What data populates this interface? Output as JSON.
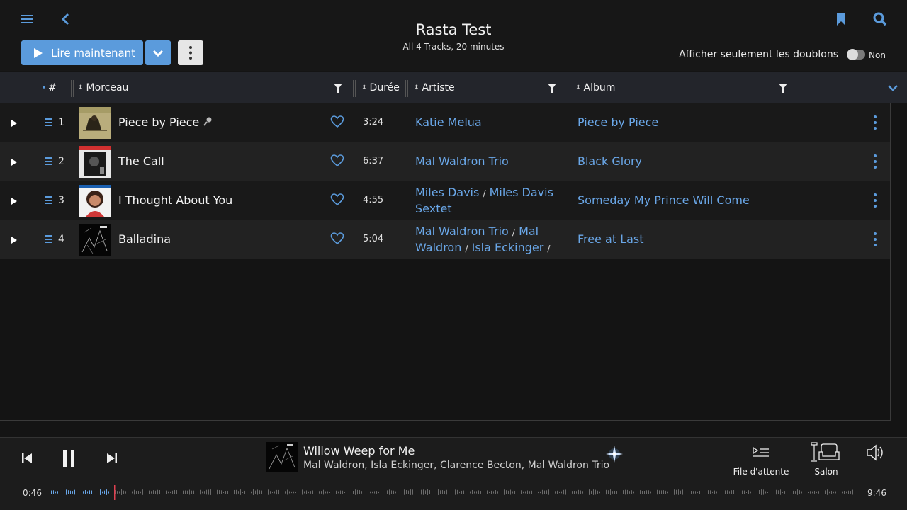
{
  "header": {
    "title": "Rasta Test",
    "subtitle": "All 4 Tracks, 20 minutes",
    "play_label": "Lire maintenant",
    "duplicates_label": "Afficher seulement les doublons",
    "duplicates_value": "Non",
    "icons": [
      "menu-icon",
      "back-chevron-icon",
      "bookmark-icon",
      "search-icon"
    ]
  },
  "columns": {
    "number": "#",
    "track": "Morceau",
    "duration": "Durée",
    "artist": "Artiste",
    "album": "Album"
  },
  "tracks": [
    {
      "num": "1",
      "title": "Piece by Piece",
      "duration": "3:24",
      "artists_line1": [
        "Katie Melua"
      ],
      "artists_line2": [],
      "album": "Piece by Piece"
    },
    {
      "num": "2",
      "title": "The Call",
      "duration": "6:37",
      "artists_line1": [
        "Mal Waldron Trio"
      ],
      "artists_line2": [],
      "album": "Black Glory"
    },
    {
      "num": "3",
      "title": "I Thought About You",
      "duration": "4:55",
      "artists_line1": [
        "Miles Davis",
        "Miles Davis"
      ],
      "artists_line2": [
        "Sextet"
      ],
      "album": "Someday My Prince Will Come"
    },
    {
      "num": "4",
      "title": "Balladina",
      "duration": "5:04",
      "artists_line1": [
        "Mal Waldron Trio",
        "Mal"
      ],
      "artists_line2": [
        "Waldron",
        "Isla Eckinger"
      ],
      "album": "Free at Last"
    }
  ],
  "now_playing": {
    "title": "Willow Weep for Me",
    "artists": "Mal Waldron, Isla Eckinger, Clarence Becton, Mal Waldron Trio",
    "queue_label": "File d'attente",
    "zone_label": "Salon",
    "elapsed": "0:46",
    "total": "9:46",
    "progress": 0.078
  },
  "colors": {
    "accent": "#5b9bdc",
    "link": "#6aa7e8",
    "playhead": "#e04050"
  }
}
